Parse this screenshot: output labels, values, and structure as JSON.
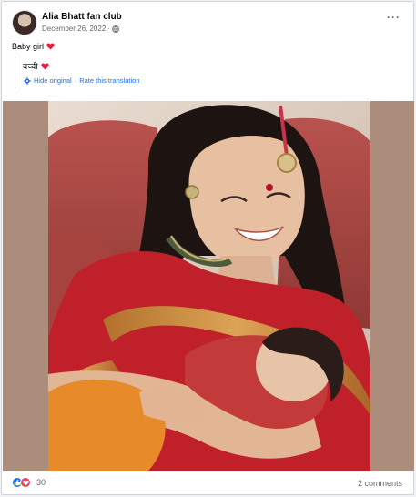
{
  "post": {
    "page_name": "Alia Bhatt fan club",
    "date": "December 26, 2022",
    "separator": "·",
    "text": "Baby girl",
    "more_icon": "more-horizontal-icon",
    "privacy_icon": "globe-icon"
  },
  "translation": {
    "text": "बच्ची",
    "hide_label": "Hide original",
    "dot": "·",
    "rate_label": "Rate this translation",
    "icon": "gear-icon"
  },
  "footer": {
    "reaction_count": "30",
    "comments_label": "2 comments"
  },
  "colors": {
    "link": "#216fdb",
    "like": "#1877f2",
    "love": "#f33e58",
    "heart": "#e41e3f",
    "photo_bg": "#ac8c7b",
    "sari_red": "#c0202a"
  }
}
